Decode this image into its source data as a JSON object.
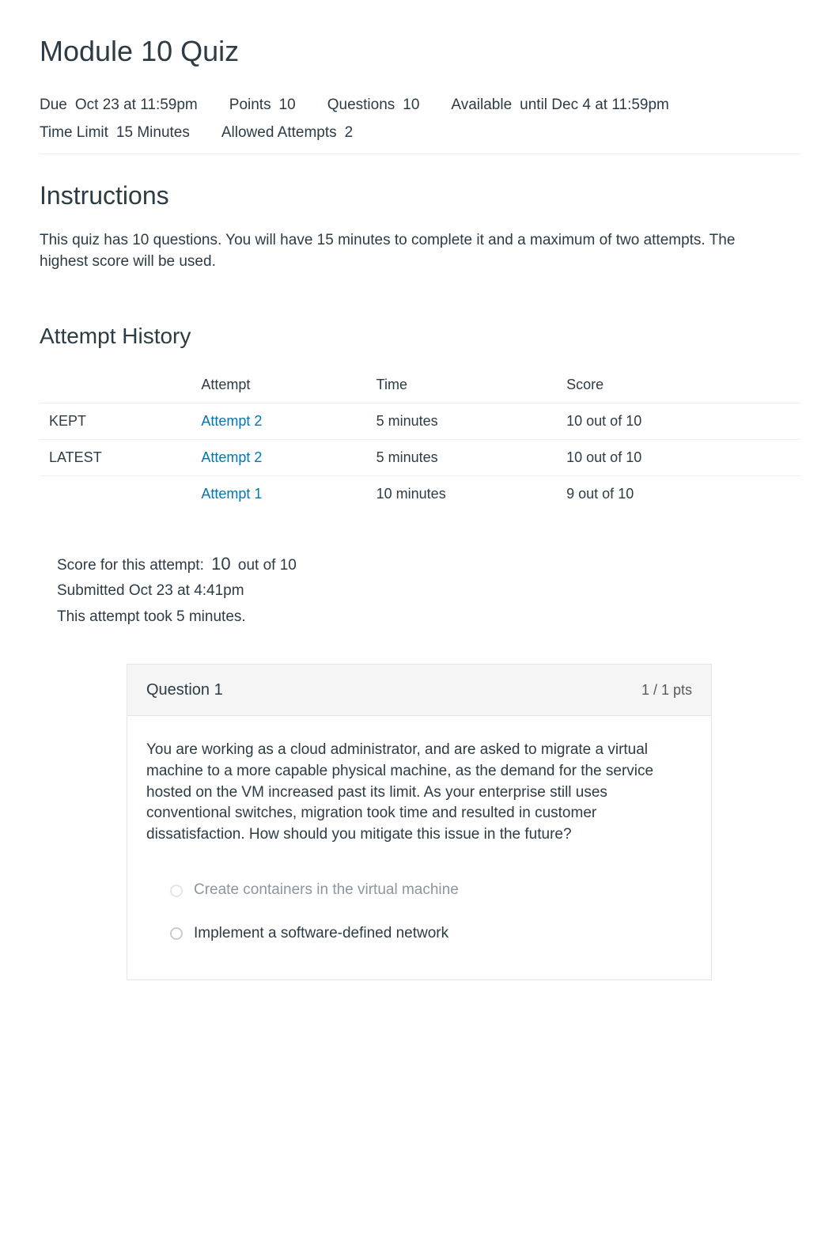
{
  "title": "Module 10 Quiz",
  "meta": {
    "due_label": "Due",
    "due_value": "Oct 23 at 11:59pm",
    "points_label": "Points",
    "points_value": "10",
    "questions_label": "Questions",
    "questions_value": "10",
    "available_label": "Available",
    "available_value": "until Dec 4 at 11:59pm",
    "timelimit_label": "Time Limit",
    "timelimit_value": "15 Minutes",
    "attempts_label": "Allowed Attempts",
    "attempts_value": "2"
  },
  "instructions_heading": "Instructions",
  "instructions_text": "This quiz has 10 questions. You will have 15 minutes to complete it and a maximum of two attempts. The highest score will be used.",
  "history_heading": "Attempt History",
  "history": {
    "headers": {
      "tag": "",
      "attempt": "Attempt",
      "time": "Time",
      "score": "Score"
    },
    "rows": [
      {
        "tag": "KEPT",
        "attempt": "Attempt 2",
        "time": "5 minutes",
        "score": "10 out of 10"
      },
      {
        "tag": "LATEST",
        "attempt": "Attempt 2",
        "time": "5 minutes",
        "score": "10 out of 10"
      },
      {
        "tag": "",
        "attempt": "Attempt 1",
        "time": "10 minutes",
        "score": "9 out of 10"
      }
    ]
  },
  "scorebox": {
    "label": "Score for this attempt:",
    "score": "10",
    "out_of": "out of 10",
    "submitted": "Submitted Oct 23 at 4:41pm",
    "took": "This attempt took 5 minutes."
  },
  "question": {
    "title": "Question 1",
    "pts": "1 / 1 pts",
    "body": "You are working as a cloud administrator, and are asked to migrate a virtual machine to a more capable physical machine, as the demand for the service hosted on the VM increased past its limit. As your enterprise still uses conventional switches, migration took time and resulted in customer dissatisfaction. How should you mitigate this issue in the future?",
    "answers": [
      {
        "text": "Create containers in the virtual machine",
        "dim": true
      },
      {
        "text": "Implement a software-defined network",
        "dim": false
      }
    ]
  }
}
